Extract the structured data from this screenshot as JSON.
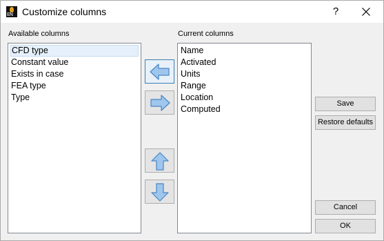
{
  "window": {
    "title": "Customize columns",
    "help_glyph": "?",
    "icon_text": "EN"
  },
  "available": {
    "label": "Available columns",
    "items": [
      "CFD type",
      "Constant value",
      "Exists in case",
      "FEA type",
      "Type"
    ],
    "selected_index": 0
  },
  "current": {
    "label": "Current columns",
    "items": [
      "Name",
      "Activated",
      "Units",
      "Range",
      "Location",
      "Computed"
    ]
  },
  "transfer_buttons": {
    "move_left_icon": "arrow-left-icon",
    "move_right_icon": "arrow-right-icon",
    "move_up_icon": "arrow-up-icon",
    "move_down_icon": "arrow-down-icon"
  },
  "buttons": {
    "save": "Save",
    "restore_defaults": "Restore defaults",
    "cancel": "Cancel",
    "ok": "OK"
  },
  "colors": {
    "arrow_fill": "#9fc6ec",
    "arrow_stroke": "#4a86c5",
    "selection_bg": "#e5f0fb"
  }
}
